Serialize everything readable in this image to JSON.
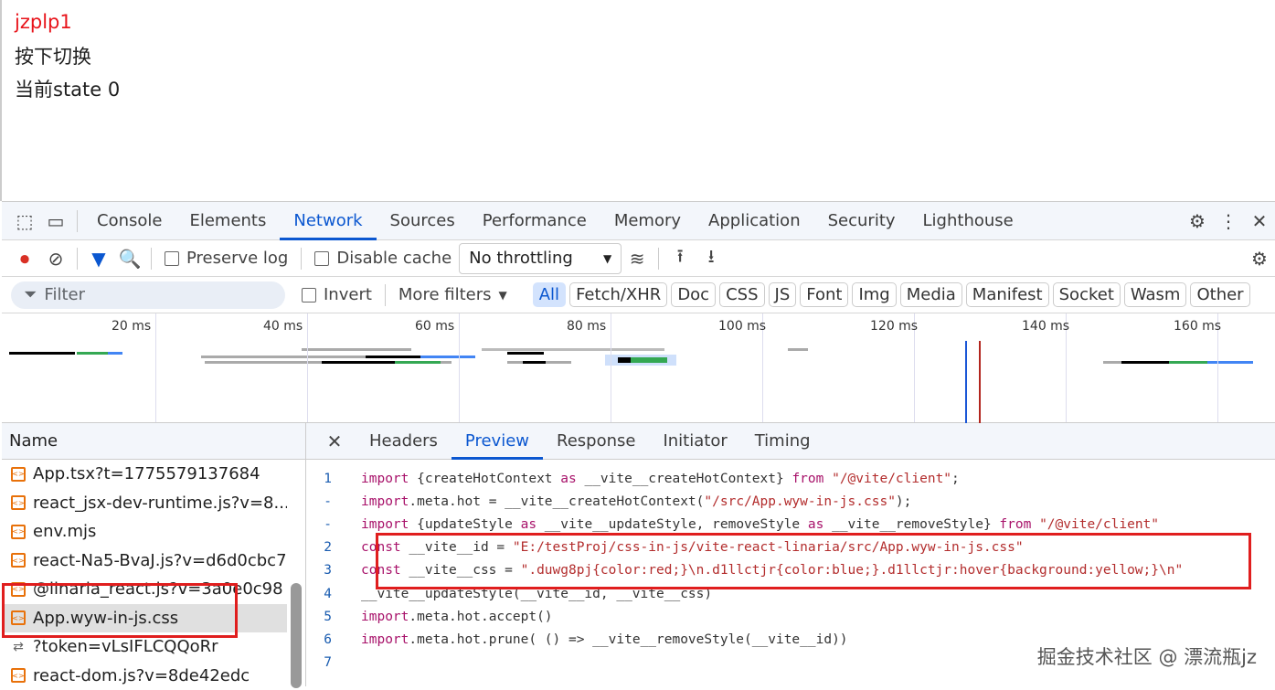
{
  "page": {
    "title": "jzplp1",
    "line2": "按下切换",
    "line3": "当前state 0"
  },
  "devtools": {
    "tabs": [
      "Console",
      "Elements",
      "Network",
      "Sources",
      "Performance",
      "Memory",
      "Application",
      "Security",
      "Lighthouse"
    ],
    "active_tab": "Network",
    "toolbar": {
      "preserve_log": "Preserve log",
      "disable_cache": "Disable cache",
      "throttling": "No throttling"
    },
    "filter": {
      "placeholder": "Filter",
      "invert": "Invert",
      "more_filters": "More filters",
      "types": [
        "All",
        "Fetch/XHR",
        "Doc",
        "CSS",
        "JS",
        "Font",
        "Img",
        "Media",
        "Manifest",
        "Socket",
        "Wasm",
        "Other"
      ]
    },
    "timeline": {
      "ticks": [
        "20 ms",
        "40 ms",
        "60 ms",
        "80 ms",
        "100 ms",
        "120 ms",
        "140 ms",
        "160 ms"
      ]
    },
    "requests": {
      "header": "Name",
      "items": [
        "App.tsx?t=1775579137684",
        "react_jsx-dev-runtime.js?v=8...",
        "env.mjs",
        "react-Na5-BvaJ.js?v=d6d0cbc7",
        "@linaria_react.js?v=3a0e0c98",
        "App.wyw-in-js.css",
        "?token=vLsIFLCQQoRr",
        "react-dom.js?v=8de42edc"
      ],
      "selected": 5
    },
    "detail": {
      "tabs": [
        "Headers",
        "Preview",
        "Response",
        "Initiator",
        "Timing"
      ],
      "active": "Preview",
      "lines": [
        {
          "n": "1",
          "tokens": [
            [
              "kw",
              "import"
            ],
            [
              "pl",
              " {createHotContext "
            ],
            [
              "kw",
              "as"
            ],
            [
              "pl",
              " __vite__createHotContext} "
            ],
            [
              "kw",
              "from"
            ],
            [
              "str",
              " \"/@vite/client\""
            ],
            [
              "pl",
              ";"
            ]
          ]
        },
        {
          "n": "-",
          "tokens": [
            [
              "kw",
              "import"
            ],
            [
              "pl",
              ".meta.hot = __vite__createHotContext("
            ],
            [
              "str",
              "\"/src/App.wyw-in-js.css\""
            ],
            [
              "pl",
              ");"
            ]
          ]
        },
        {
          "n": "-",
          "tokens": [
            [
              "kw",
              "import"
            ],
            [
              "pl",
              " {updateStyle "
            ],
            [
              "kw",
              "as"
            ],
            [
              "pl",
              " __vite__updateStyle, removeStyle "
            ],
            [
              "kw",
              "as"
            ],
            [
              "pl",
              " __vite__removeStyle} "
            ],
            [
              "kw",
              "from"
            ],
            [
              "str",
              " \"/@vite/client\""
            ]
          ]
        },
        {
          "n": "2",
          "tokens": [
            [
              "kw",
              "const"
            ],
            [
              "pl",
              " __vite__id = "
            ],
            [
              "str",
              "\"E:/testProj/css-in-js/vite-react-linaria/src/App.wyw-in-js.css\""
            ]
          ]
        },
        {
          "n": "3",
          "tokens": [
            [
              "kw",
              "const"
            ],
            [
              "pl",
              " __vite__css = "
            ],
            [
              "str",
              "\".duwg8pj{color:red;}\\n.d1llctjr{color:blue;}.d1llctjr:hover{background:yellow;}\\n\""
            ]
          ]
        },
        {
          "n": "4",
          "tokens": [
            [
              "pl",
              "__vite__updateStyle(__vite__id, __vite__css)"
            ]
          ]
        },
        {
          "n": "5",
          "tokens": [
            [
              "kw",
              "import"
            ],
            [
              "pl",
              ".meta.hot.accept()"
            ]
          ]
        },
        {
          "n": "6",
          "tokens": [
            [
              "kw",
              "import"
            ],
            [
              "pl",
              ".meta.hot.prune( () => __vite__removeStyle(__vite__id))"
            ]
          ]
        },
        {
          "n": "7",
          "tokens": []
        }
      ]
    }
  },
  "watermark": "掘金技术社区 @ 漂流瓶jz"
}
